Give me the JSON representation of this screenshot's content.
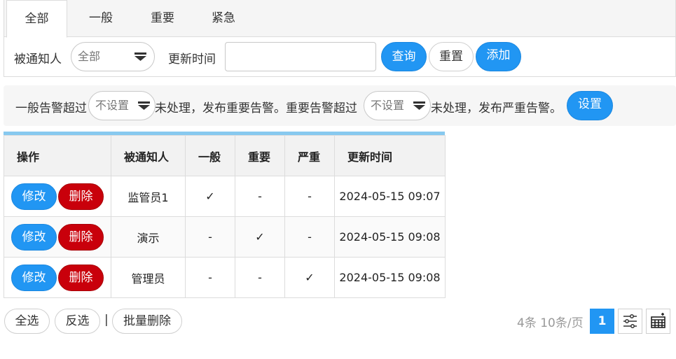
{
  "tabs": [
    {
      "label": "全部",
      "active": true
    },
    {
      "label": "一般",
      "active": false
    },
    {
      "label": "重要",
      "active": false
    },
    {
      "label": "紧急",
      "active": false
    }
  ],
  "filter": {
    "notifier_label": "被通知人",
    "notifier_value": "全部",
    "update_time_label": "更新时间",
    "update_time_value": "",
    "search_label": "查询",
    "reset_label": "重置",
    "add_label": "添加"
  },
  "alert_settings": {
    "text1": "一般告警超过",
    "select1_value": "不设置",
    "text2": "未处理，发布重要告警。重要告警超过",
    "select2_value": "不设置",
    "text3": "未处理，发布严重告警。",
    "set_label": "设置"
  },
  "table": {
    "columns": [
      "操作",
      "被通知人",
      "一般",
      "重要",
      "严重",
      "更新时间"
    ],
    "edit_label": "修改",
    "delete_label": "删除",
    "rows": [
      {
        "name": "监管员1",
        "general": "✓",
        "important": "-",
        "severe": "-",
        "updated": "2024-05-15 09:07"
      },
      {
        "name": "演示",
        "general": "-",
        "important": "✓",
        "severe": "-",
        "updated": "2024-05-15 09:08"
      },
      {
        "name": "管理员",
        "general": "-",
        "important": "-",
        "severe": "✓",
        "updated": "2024-05-15 09:08"
      }
    ]
  },
  "footer": {
    "select_all": "全选",
    "invert": "反选",
    "separator": "|",
    "batch_delete": "批量删除",
    "pager_info": "4条 10条/页",
    "current_page": "1"
  },
  "colors": {
    "primary": "#2196f3",
    "danger": "#c9000b",
    "table_accent": "#87c9ef"
  },
  "icons": {
    "caret": "caret-down-icon",
    "columns": "sliders-icon",
    "export": "table-export-icon"
  }
}
